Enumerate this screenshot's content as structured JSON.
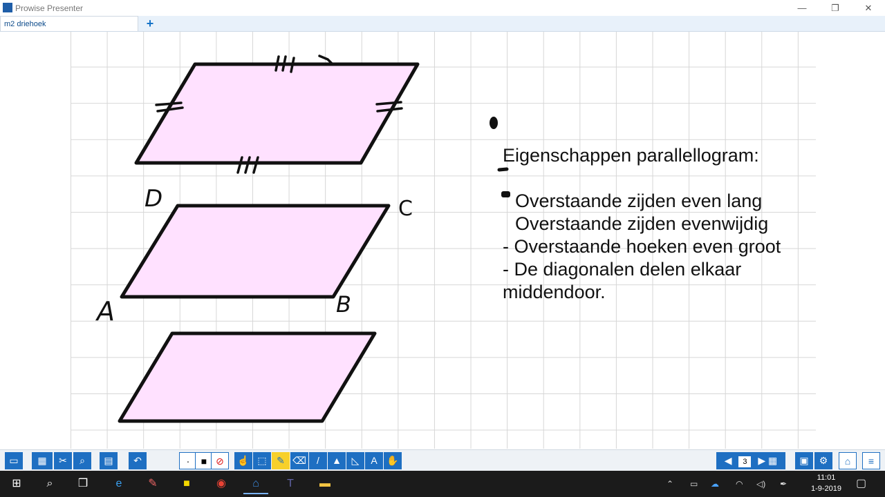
{
  "app": {
    "title": "Prowise Presenter"
  },
  "tabs": [
    {
      "label": "m2 driehoek"
    }
  ],
  "canvas": {
    "labels": {
      "D": "D",
      "C": "C",
      "A": "A",
      "B": "B"
    },
    "text": {
      "heading": "Eigenschappen parallellogram:",
      "items": [
        "Overstaande zijden even lang",
        "Overstaande zijden evenwijdig",
        "- Overstaande hoeken even groot",
        "- De diagonalen delen elkaar",
        "middendoor."
      ]
    },
    "colors": {
      "fill": "#ffe1ff",
      "stroke": "#111111"
    }
  },
  "toolbar": {
    "page_number": "3"
  },
  "taskbar": {
    "time": "11:01",
    "date": "1-9-2019"
  }
}
